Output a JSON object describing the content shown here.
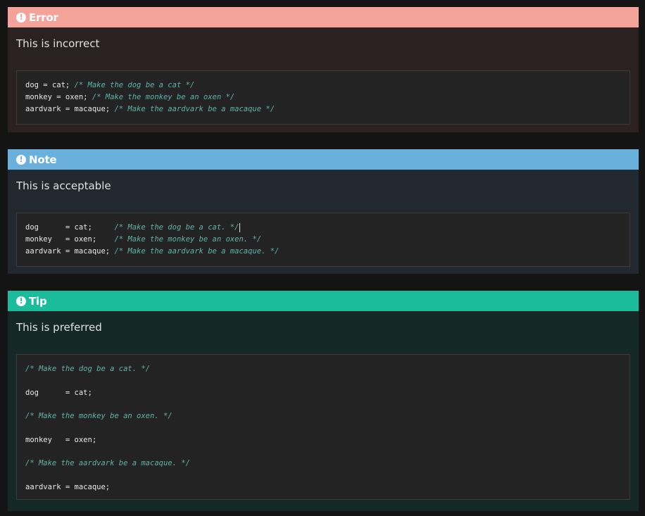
{
  "error": {
    "title": "Error",
    "text": "This is incorrect",
    "code": [
      {
        "code": "dog = cat; ",
        "comment": "/* Make the dog be a cat */"
      },
      {
        "code": "monkey = oxen; ",
        "comment": "/* Make the monkey be an oxen */"
      },
      {
        "code": "aardvark = macaque; ",
        "comment": "/* Make the aardvark be a macaque */"
      }
    ]
  },
  "note": {
    "title": "Note",
    "text": "This is acceptable",
    "code": [
      {
        "code": "dog      = cat;     ",
        "comment": "/* Make the dog be a cat. */"
      },
      {
        "code": "monkey   = oxen;    ",
        "comment": "/* Make the monkey be an oxen. */"
      },
      {
        "code": "aardvark = macaque; ",
        "comment": "/* Make the aardvark be a macaque. */"
      }
    ]
  },
  "tip": {
    "title": "Tip",
    "text": "This is preferred",
    "lines": [
      {
        "comment": "/* Make the dog be a cat. */"
      },
      {
        "code": ""
      },
      {
        "code": "dog      = cat;"
      },
      {
        "code": ""
      },
      {
        "comment": "/* Make the monkey be an oxen. */"
      },
      {
        "code": ""
      },
      {
        "code": "monkey   = oxen;"
      },
      {
        "code": ""
      },
      {
        "comment": "/* Make the aardvark be a macaque. */"
      },
      {
        "code": ""
      },
      {
        "code": "aardvark = macaque;"
      }
    ]
  },
  "colors": {
    "error_accent": "#f4a39b",
    "note_accent": "#6ab0dc",
    "tip_accent": "#1bbc9b",
    "comment": "#5fb3a8"
  },
  "icons": {
    "admonition": "exclamation-circle-icon"
  }
}
